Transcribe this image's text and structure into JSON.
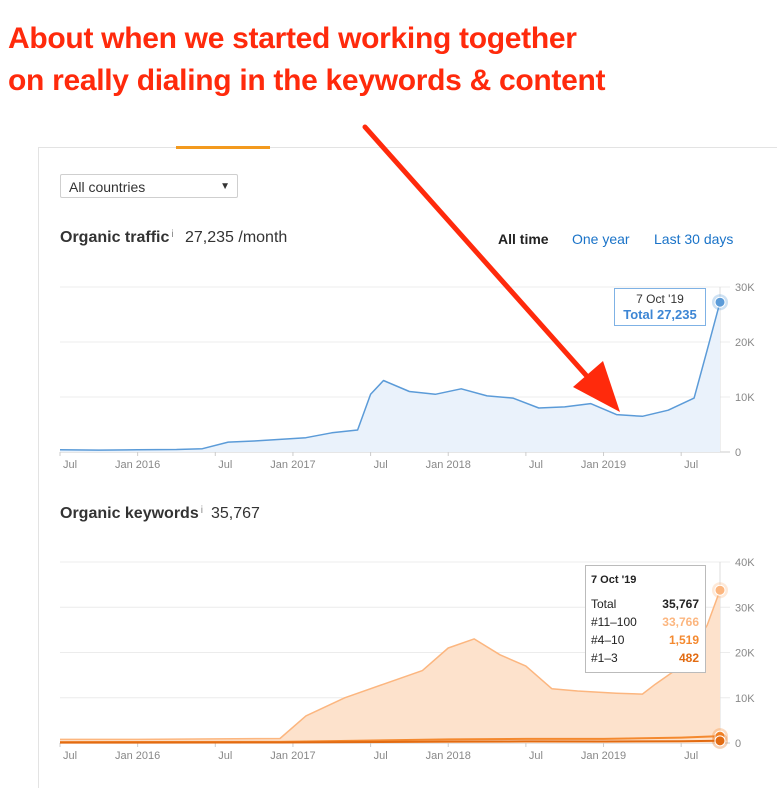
{
  "annotation": {
    "line1": "About when we started working together",
    "line2": "on really dialing in the keywords & content"
  },
  "filters": {
    "country_select": "All countries"
  },
  "time_ranges": {
    "all_time": "All time",
    "one_year": "One year",
    "last_30_days": "Last 30 days"
  },
  "colors": {
    "traffic_line": "#5b9bd8",
    "traffic_fill": "#eaf2fb",
    "keywords_11_100": "#fcb67f",
    "keywords_fill": "#fde2cc",
    "keywords_4_10": "#f4892f",
    "keywords_1_3": "#e26b12",
    "annotation_red": "#ff2a0c"
  },
  "organic_traffic": {
    "title": "Organic traffic",
    "info": "i",
    "value": "27,235 /month",
    "tooltip_date": "7 Oct '19",
    "tooltip_value": "Total 27,235"
  },
  "organic_keywords": {
    "title": "Organic keywords",
    "info": "i",
    "value": "35,767",
    "tooltip": {
      "date": "7 Oct '19",
      "rows": [
        {
          "label": "Total",
          "value": "35,767"
        },
        {
          "label": "#11–100",
          "value": "33,766"
        },
        {
          "label": "#4–10",
          "value": "1,519"
        },
        {
          "label": "#1–3",
          "value": "482"
        }
      ]
    }
  },
  "chart_data": [
    {
      "type": "area",
      "title": "Organic traffic",
      "x_tick_labels": [
        "Jul",
        "Jan 2016",
        "Jul",
        "Jan 2017",
        "Jul",
        "Jan 2018",
        "Jul",
        "Jan 2019",
        "Jul"
      ],
      "y_tick_labels": [
        "30K",
        "20K",
        "10K",
        "0"
      ],
      "ylim": [
        0,
        30000
      ],
      "grid": true,
      "series": [
        {
          "x": [
            "2015-07",
            "2015-10",
            "2016-01",
            "2016-04",
            "2016-06",
            "2016-08",
            "2016-10",
            "2016-12",
            "2017-02",
            "2017-04",
            "2017-06",
            "2017-07",
            "2017-08",
            "2017-10",
            "2017-12",
            "2018-02",
            "2018-04",
            "2018-06",
            "2018-08",
            "2018-10",
            "2018-12",
            "2019-02",
            "2019-04",
            "2019-06",
            "2019-08",
            "2019-09",
            "2019-10"
          ],
          "values": [
            400,
            350,
            400,
            450,
            600,
            1800,
            2000,
            2300,
            2600,
            3500,
            4000,
            10500,
            13000,
            11000,
            10500,
            11500,
            10200,
            9800,
            8000,
            8200,
            8800,
            6800,
            6500,
            7600,
            9800,
            18500,
            27235
          ]
        }
      ]
    },
    {
      "type": "area",
      "title": "Organic keywords",
      "x_tick_labels": [
        "Jul",
        "Jan 2016",
        "Jul",
        "Jan 2017",
        "Jul",
        "Jan 2018",
        "Jul",
        "Jan 2019",
        "Jul"
      ],
      "y_tick_labels": [
        "40K",
        "30K",
        "20K",
        "10K",
        "0"
      ],
      "ylim": [
        0,
        40000
      ],
      "grid": true,
      "series": [
        {
          "name": "#11–100",
          "x": [
            "2015-07",
            "2016-01",
            "2016-07",
            "2016-12",
            "2017-02",
            "2017-05",
            "2017-08",
            "2017-11",
            "2018-01",
            "2018-03",
            "2018-05",
            "2018-07",
            "2018-09",
            "2018-11",
            "2019-02",
            "2019-04",
            "2019-05",
            "2019-07",
            "2019-09",
            "2019-10"
          ],
          "values": [
            800,
            800,
            900,
            1000,
            6000,
            10000,
            13000,
            16000,
            21000,
            23000,
            19500,
            17000,
            12000,
            11500,
            11000,
            10800,
            13000,
            17000,
            26000,
            33766
          ]
        },
        {
          "name": "#4–10",
          "x": [
            "2015-07",
            "2016-12",
            "2017-06",
            "2018-01",
            "2018-07",
            "2019-01",
            "2019-07",
            "2019-10"
          ],
          "values": [
            200,
            250,
            500,
            800,
            900,
            900,
            1200,
            1519
          ]
        },
        {
          "name": "#1–3",
          "x": [
            "2015-07",
            "2016-12",
            "2017-06",
            "2018-01",
            "2018-07",
            "2019-01",
            "2019-07",
            "2019-10"
          ],
          "values": [
            80,
            100,
            200,
            300,
            350,
            330,
            400,
            482
          ]
        }
      ]
    }
  ]
}
